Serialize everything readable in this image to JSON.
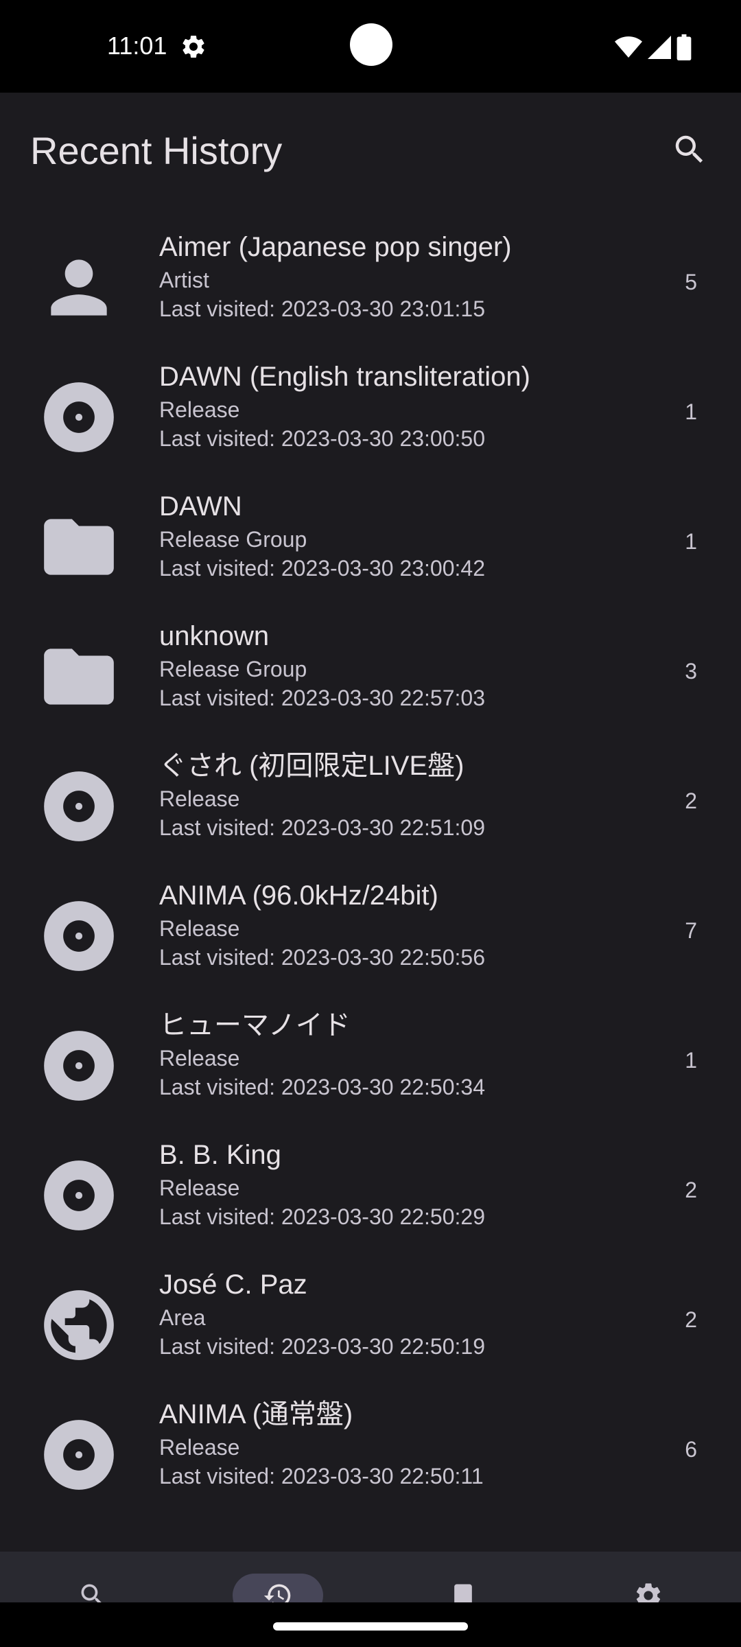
{
  "status_bar": {
    "time": "11:01"
  },
  "header": {
    "title": "Recent History"
  },
  "history": [
    {
      "name": "Aimer (Japanese pop singer)",
      "type": "Artist",
      "visited": "Last visited: 2023-03-30 23:01:15",
      "count": "5",
      "icon": "person-icon"
    },
    {
      "name": "DAWN (English transliteration)",
      "type": "Release",
      "visited": "Last visited: 2023-03-30 23:00:50",
      "count": "1",
      "icon": "disc-icon"
    },
    {
      "name": "DAWN",
      "type": "Release Group",
      "visited": "Last visited: 2023-03-30 23:00:42",
      "count": "1",
      "icon": "folder-icon"
    },
    {
      "name": "unknown",
      "type": "Release Group",
      "visited": "Last visited: 2023-03-30 22:57:03",
      "count": "3",
      "icon": "folder-icon"
    },
    {
      "name": "ぐされ (初回限定LIVE盤)",
      "type": "Release",
      "visited": "Last visited: 2023-03-30 22:51:09",
      "count": "2",
      "icon": "disc-icon"
    },
    {
      "name": "ANIMA (96.0kHz/24bit)",
      "type": "Release",
      "visited": "Last visited: 2023-03-30 22:50:56",
      "count": "7",
      "icon": "disc-icon"
    },
    {
      "name": "ヒューマノイド",
      "type": "Release",
      "visited": "Last visited: 2023-03-30 22:50:34",
      "count": "1",
      "icon": "disc-icon"
    },
    {
      "name": "B. B. King",
      "type": "Release",
      "visited": "Last visited: 2023-03-30 22:50:29",
      "count": "2",
      "icon": "disc-icon"
    },
    {
      "name": "José C. Paz",
      "type": "Area",
      "visited": "Last visited: 2023-03-30 22:50:19",
      "count": "2",
      "icon": "globe-icon"
    },
    {
      "name": "ANIMA (通常盤)",
      "type": "Release",
      "visited": "Last visited: 2023-03-30 22:50:11",
      "count": "6",
      "icon": "disc-icon"
    }
  ],
  "nav": [
    {
      "label": "Search",
      "icon": "search-icon",
      "active": false
    },
    {
      "label": "History",
      "icon": "history-icon",
      "active": true
    },
    {
      "label": "Collections",
      "icon": "bookmark-icon",
      "active": false
    },
    {
      "label": "Settings",
      "icon": "gear-icon",
      "active": false
    }
  ],
  "colors": {
    "background": "#1c1b1f",
    "icon": "#c9c8d2",
    "nav_background": "#292930",
    "nav_active_pill": "#474658"
  }
}
